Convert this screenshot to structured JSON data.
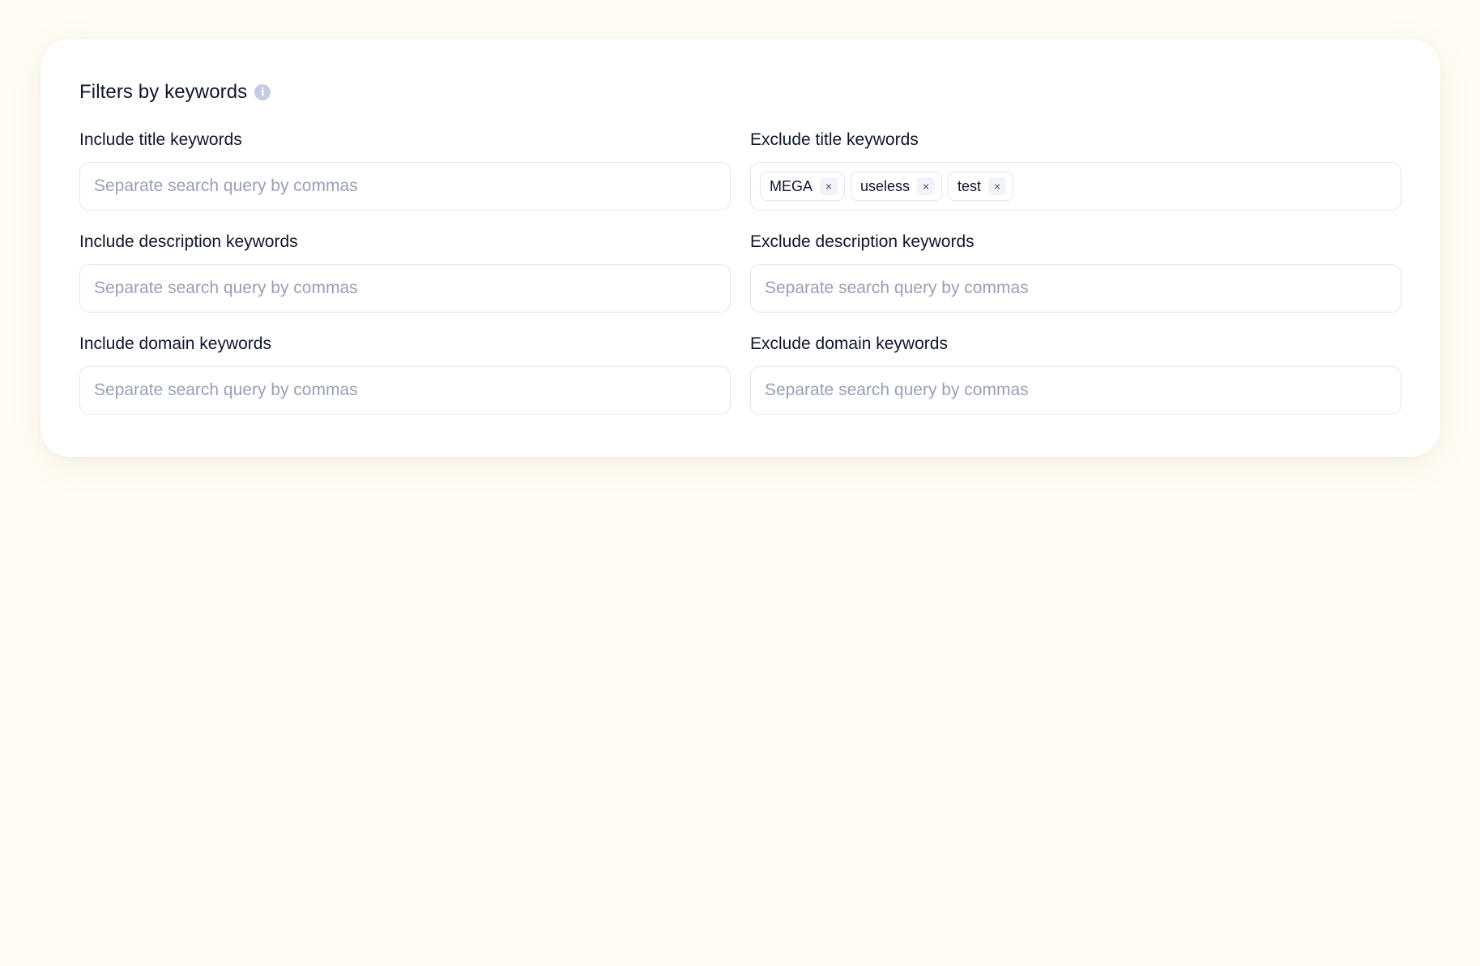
{
  "card": {
    "title": "Filters by keywords",
    "info_icon": "info-icon"
  },
  "fields": {
    "include_title": {
      "label": "Include title keywords",
      "placeholder": "Separate search query by commas"
    },
    "exclude_title": {
      "label": "Exclude title keywords",
      "tags": [
        {
          "label": "MEGA",
          "remove_icon": "×"
        },
        {
          "label": "useless",
          "remove_icon": "×"
        },
        {
          "label": "test",
          "remove_icon": "×"
        }
      ]
    },
    "include_description": {
      "label": "Include description keywords",
      "placeholder": "Separate search query by commas"
    },
    "exclude_description": {
      "label": "Exclude description keywords",
      "placeholder": "Separate search query by commas"
    },
    "include_domain": {
      "label": "Include domain keywords",
      "placeholder": "Separate search query by commas"
    },
    "exclude_domain": {
      "label": "Exclude domain keywords",
      "placeholder": "Separate search query by commas"
    }
  },
  "colors": {
    "page_background": "#fffcf4",
    "card_background": "#ffffff",
    "text": "#0f172a",
    "placeholder": "#98a0b6",
    "border": "#e3e6ee",
    "info_icon": "#c7cce2"
  }
}
